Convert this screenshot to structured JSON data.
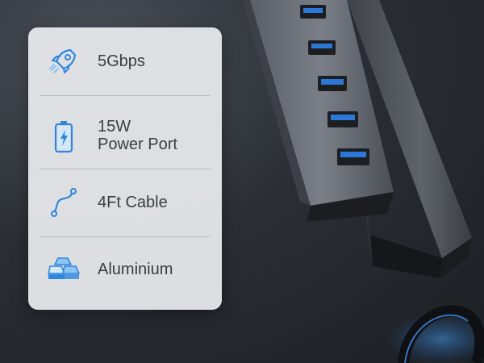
{
  "features": [
    {
      "icon": "rocket-icon",
      "label": "5Gbps"
    },
    {
      "icon": "battery-charging-icon",
      "label_line1": "15W",
      "label_line2": "Power Port"
    },
    {
      "icon": "cable-icon",
      "label": "4Ft Cable"
    },
    {
      "icon": "metal-ingots-icon",
      "label": "Aluminium"
    }
  ],
  "colors": {
    "icon_blue": "#2f86e0",
    "icon_blue_light": "#8cc4f2",
    "port_blue": "#2a78d8",
    "card_bg": "#e8eaed",
    "text": "#3a3d42"
  }
}
